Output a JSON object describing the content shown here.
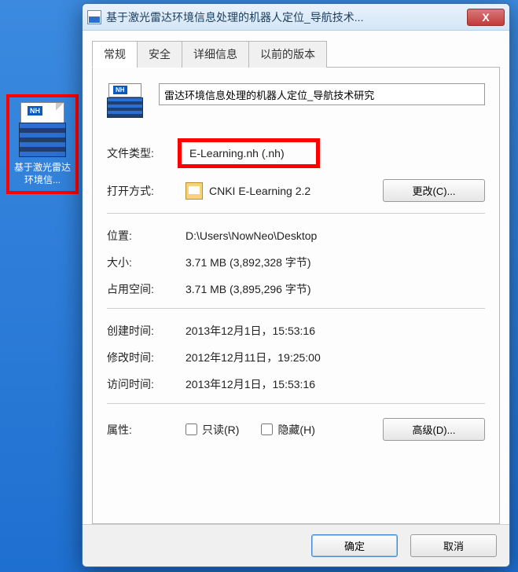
{
  "desktop_icon": {
    "badge": "NH",
    "label": "基于激光雷达环境信..."
  },
  "window": {
    "title": "基于激光雷达环境信息处理的机器人定位_导航技术...",
    "close": "X"
  },
  "tabs": {
    "general": "常规",
    "security": "安全",
    "details": "详细信息",
    "previous": "以前的版本"
  },
  "file": {
    "badge": "NH",
    "name": "雷达环境信息处理的机器人定位_导航技术研究"
  },
  "labels": {
    "type": "文件类型:",
    "openwith": "打开方式:",
    "location": "位置:",
    "size": "大小:",
    "size_on_disk": "占用空间:",
    "created": "创建时间:",
    "modified": "修改时间:",
    "accessed": "访问时间:",
    "attributes": "属性:"
  },
  "values": {
    "type": "E-Learning.nh (.nh)",
    "openwith": "CNKI E-Learning 2.2",
    "location": "D:\\Users\\NowNeo\\Desktop",
    "size": "3.71 MB (3,892,328 字节)",
    "size_on_disk": "3.71 MB (3,895,296 字节)",
    "created": "2013年12月1日，15:53:16",
    "modified": "2012年12月11日，19:25:00",
    "accessed": "2013年12月1日，15:53:16"
  },
  "buttons": {
    "change": "更改(C)...",
    "advanced": "高级(D)...",
    "ok": "确定",
    "cancel": "取消"
  },
  "checkboxes": {
    "readonly": "只读(R)",
    "hidden": "隐藏(H)"
  }
}
